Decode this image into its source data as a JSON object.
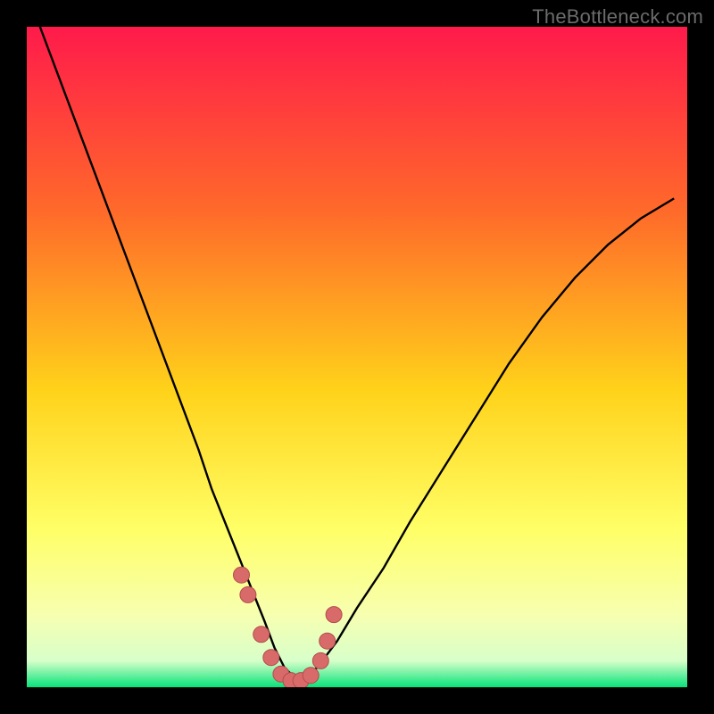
{
  "watermark": "TheBottleneck.com",
  "colors": {
    "frame": "#000000",
    "grad_top": "#ff1a4b",
    "grad_mid1": "#ff6a2a",
    "grad_mid2": "#ffd21a",
    "grad_mid3": "#ffff66",
    "grad_low": "#f7ffb0",
    "grad_green": "#07e37a",
    "curve": "#000000",
    "marker_fill": "#d86a6a",
    "marker_stroke": "#b34d4d"
  },
  "chart_data": {
    "type": "line",
    "title": "",
    "xlabel": "",
    "ylabel": "",
    "xlim": [
      0,
      100
    ],
    "ylim": [
      0,
      100
    ],
    "series": [
      {
        "name": "bottleneck-curve",
        "x": [
          2,
          5,
          8,
          11,
          14,
          17,
          20,
          23,
          26,
          28,
          30,
          32,
          34,
          36,
          37.5,
          39,
          40.5,
          42,
          44,
          47,
          50,
          54,
          58,
          63,
          68,
          73,
          78,
          83,
          88,
          93,
          98
        ],
        "y": [
          100,
          92,
          84,
          76,
          68,
          60,
          52,
          44,
          36,
          30,
          25,
          20,
          15,
          10,
          6,
          3,
          1.5,
          1.5,
          3,
          7,
          12,
          18,
          25,
          33,
          41,
          49,
          56,
          62,
          67,
          71,
          74
        ]
      }
    ],
    "markers": {
      "name": "highlight-points",
      "x": [
        32.5,
        33.5,
        35.5,
        37,
        38.5,
        40,
        41.5,
        43,
        44.5,
        45.5,
        46.5
      ],
      "y": [
        17,
        14,
        8,
        4.5,
        2,
        1,
        1,
        1.8,
        4,
        7,
        11
      ]
    },
    "optimum_x": 40
  }
}
